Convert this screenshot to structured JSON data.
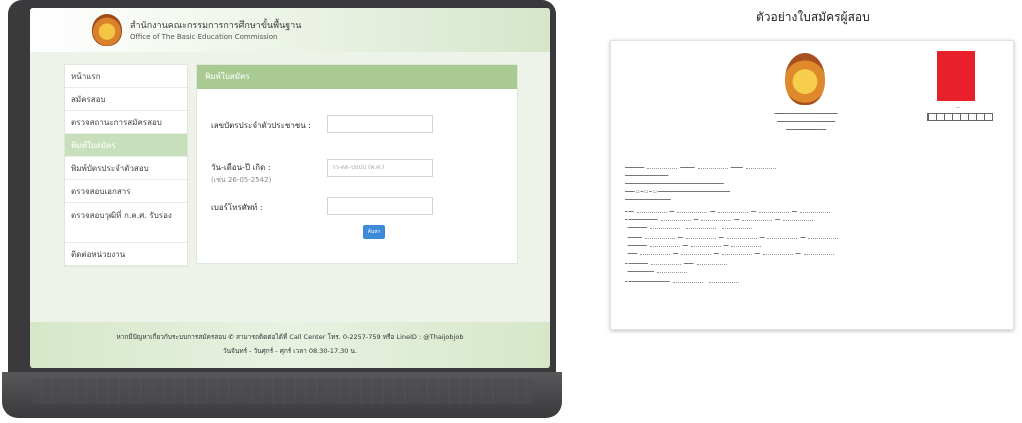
{
  "caption": "ตัวอย่างใบสมัครผู้สอบ",
  "header": {
    "title_th": "สำนักงานคณะกรรมการการศึกษาขั้นพื้นฐาน",
    "title_en": "Office of The Basic Education Commission"
  },
  "sidebar": {
    "items": [
      {
        "label": "หน้าแรก",
        "active": false
      },
      {
        "label": "สมัครสอบ",
        "active": false
      },
      {
        "label": "ตรวจสถานะการสมัครสอบ",
        "active": false
      },
      {
        "label": "พิมพ์ใบสมัคร",
        "active": true
      },
      {
        "label": "พิมพ์บัตรประจำตัวสอบ",
        "active": false
      },
      {
        "label": "ตรวจสอบเอกสาร",
        "active": false
      },
      {
        "label": "ตรวจสอบวุฒิที่ ก.ค.ศ. รับรอง",
        "active": false
      },
      {
        "label": "ติดต่อหน่วยงาน",
        "active": false
      }
    ]
  },
  "form": {
    "title": "พิมพ์ใบสมัคร",
    "id_label": "เลขบัตรประจำตัวประชาชน :",
    "id_value": "",
    "dob_label": "วัน-เดือน-ปี เกิด :",
    "dob_hint": "(เช่น 26-05-2542)",
    "dob_placeholder": "วว-ดด-ปปปป (พ.ศ.)",
    "phone_label": "เบอร์โทรศัพท์ :",
    "phone_value": "",
    "submit_label": "ค้นหา"
  },
  "footer": {
    "line1": "หากมีปัญหาเกี่ยวกับระบบการสมัครสอบ ✆ สามารถติดต่อได้ที่ Call Center โทร. 0-2257-759 หรือ LineID : @Thaijobjob",
    "line2": "วันจันทร์ - วันศุกร์ - ศุกร์ เวลา 08.30-17.30 น."
  },
  "colors": {
    "accent_green": "#a9cb93",
    "sidebar_active": "#c8dfbb",
    "button_blue": "#3c8ad8",
    "photo_red": "#e8202a"
  }
}
